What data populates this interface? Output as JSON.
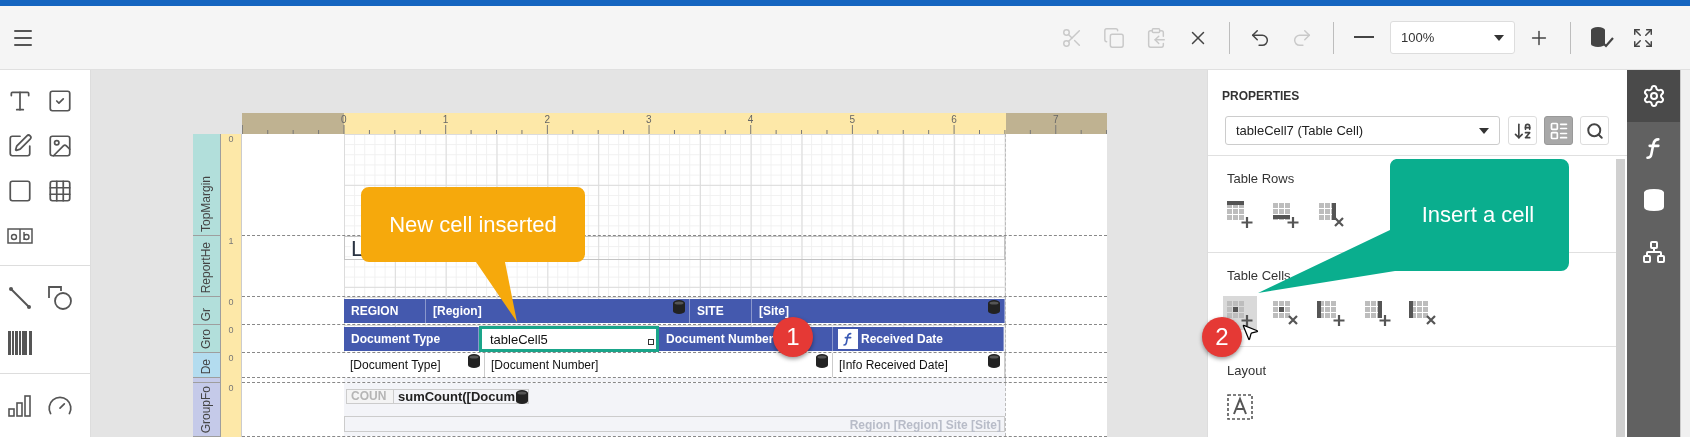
{
  "toolbar": {
    "buttons": [
      {
        "kind": "cut",
        "disabled": true
      },
      {
        "kind": "copy",
        "disabled": true
      },
      {
        "kind": "paste",
        "disabled": true
      },
      {
        "kind": "delete",
        "disabled": false
      },
      {
        "kind": "undo",
        "disabled": false
      },
      {
        "kind": "redo",
        "disabled": true
      },
      {
        "kind": "zoom_out",
        "disabled": false
      },
      {
        "kind": "zoom",
        "value": "100%"
      },
      {
        "kind": "zoom_in",
        "disabled": false
      },
      {
        "kind": "validate",
        "disabled": false
      },
      {
        "kind": "fullscreen",
        "disabled": false
      }
    ]
  },
  "toolbox": [
    [
      {
        "kind": "label"
      },
      {
        "kind": "checkbox"
      },
      {
        "kind": "richtext"
      },
      {
        "kind": "picture"
      },
      {
        "kind": "panel"
      },
      {
        "kind": "table"
      },
      {
        "kind": "charactercomb"
      }
    ],
    [
      {
        "kind": "line"
      },
      {
        "kind": "shape"
      },
      {
        "kind": "barcode"
      }
    ],
    [
      {
        "kind": "chart"
      },
      {
        "kind": "gauge"
      }
    ]
  ],
  "ruler": {
    "marks": [
      "0",
      "1",
      "2",
      "3",
      "4",
      "5",
      "6",
      "7"
    ]
  },
  "bands": [
    {
      "kind": "top_margin",
      "label": "TopMargin",
      "ruler_label": "0"
    },
    {
      "kind": "report_header",
      "label": "ReportHe",
      "ruler_label": "1",
      "text": "L"
    },
    {
      "kind": "group_header",
      "label": "Gr",
      "ruler_label": "0",
      "cells": [
        {
          "kind": "caption",
          "text": "REGION"
        },
        {
          "kind": "field",
          "text": "[Region]"
        },
        {
          "kind": "caption",
          "text": "SITE"
        },
        {
          "kind": "field",
          "text": "[Site]"
        }
      ]
    },
    {
      "kind": "group_header",
      "label": "Gro",
      "ruler_label": "0",
      "cells": [
        {
          "kind": "caption",
          "text": "Document Type",
          "highlighted": false
        },
        {
          "kind": "new",
          "text": "tableCell5",
          "highlighted": true
        },
        {
          "kind": "caption",
          "text": "Document Number",
          "highlighted": false
        },
        {
          "kind": "expression",
          "text": "Received Date",
          "highlighted": false
        }
      ]
    },
    {
      "kind": "detail",
      "label": "De",
      "ruler_label": "0",
      "cells": [
        {
          "kind": "field",
          "text": "[Document Type]"
        },
        {
          "kind": "field",
          "text": "[Document Number]"
        },
        {
          "kind": "field",
          "text": "[Info Received Date]"
        }
      ]
    },
    {
      "kind": "gap"
    },
    {
      "kind": "group_footer",
      "label": "GroupFo",
      "ruler_label": "0",
      "cells": [
        {
          "kind": "caption",
          "text": "COUN"
        },
        {
          "kind": "field",
          "text": "sumCount([Docum"
        }
      ],
      "footer_text": "Region [Region] Site [Site]"
    }
  ],
  "properties": {
    "title": "PROPERTIES",
    "selected_object": "tableCell7 (Table Cell)",
    "view_buttons": [
      {
        "kind": "sort",
        "selected": false
      },
      {
        "kind": "categories",
        "selected": true
      },
      {
        "kind": "search",
        "selected": false
      }
    ],
    "sections": [
      {
        "title": "Table Rows",
        "actions": [
          {
            "kind": "insert_row_above",
            "hovered": false
          },
          {
            "kind": "insert_row_below",
            "hovered": false
          },
          {
            "kind": "delete_row",
            "hovered": false
          }
        ]
      },
      {
        "title": "Table Cells",
        "actions": [
          {
            "kind": "insert_cell",
            "hovered": true
          },
          {
            "kind": "delete_cell",
            "hovered": false
          },
          {
            "kind": "insert_column_left",
            "hovered": false
          },
          {
            "kind": "insert_column_right",
            "hovered": false
          },
          {
            "kind": "delete_column",
            "hovered": false
          }
        ]
      },
      {
        "title": "Layout",
        "actions": [
          {
            "kind": "fit_text",
            "hovered": false
          }
        ]
      }
    ]
  },
  "side_tabs": [
    {
      "kind": "properties",
      "selected": true
    },
    {
      "kind": "expressions",
      "selected": false
    },
    {
      "kind": "data",
      "selected": false
    },
    {
      "kind": "outline",
      "selected": false
    }
  ],
  "callouts": [
    {
      "kind": "orange",
      "text": "New cell inserted"
    },
    {
      "kind": "green",
      "text": "Insert a cell"
    }
  ],
  "badges": [
    "1",
    "2"
  ]
}
